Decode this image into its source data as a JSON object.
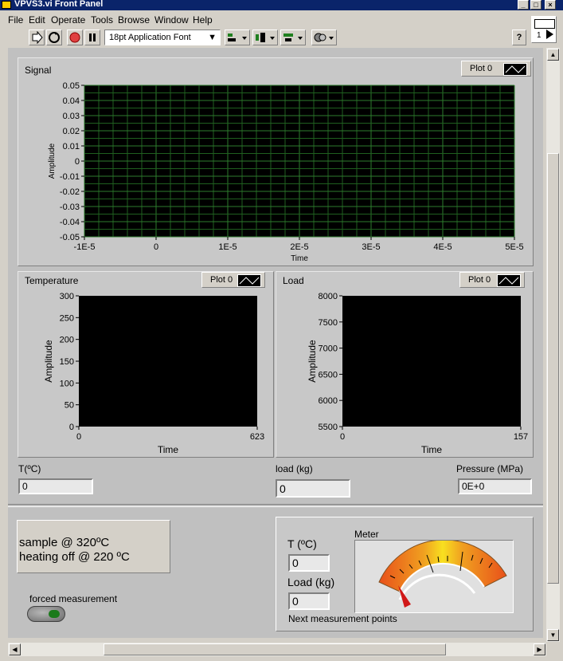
{
  "window": {
    "title": "VPVS3.vi Front Panel"
  },
  "menu": [
    "File",
    "Edit",
    "Operate",
    "Tools",
    "Browse",
    "Window",
    "Help"
  ],
  "toolbar": {
    "font_select": "18pt Application Font",
    "help": "?",
    "vi_icon_label": "1"
  },
  "signal_chart": {
    "label": "Signal",
    "legend": "Plot 0"
  },
  "temperature_chart": {
    "label": "Temperature",
    "legend": "Plot 0"
  },
  "load_chart": {
    "label": "Load",
    "legend": "Plot 0"
  },
  "indicators": {
    "t_label": "T(ºC)",
    "t_value": "0",
    "load_label": "load (kg)",
    "load_value": "0",
    "pressure_label": "Pressure (MPa)",
    "pressure_value": "0E+0"
  },
  "status": {
    "line1": "sample @ 320ºC",
    "line2": "heating off @ 220 ºC"
  },
  "forced": {
    "label": "forced measurement"
  },
  "next": {
    "t_label": "T (ºC)",
    "t_value": "0",
    "load_label": "Load (kg)",
    "load_value": "0",
    "caption": "Next measurement points",
    "meter_label": "Meter"
  },
  "chart_data": [
    {
      "type": "line",
      "title": "Signal",
      "xlabel": "Time",
      "ylabel": "Amplitude",
      "xlim": [
        -1e-05,
        5e-05
      ],
      "ylim": [
        -0.05,
        0.05
      ],
      "xticks": [
        "-1E-5",
        "0",
        "1E-5",
        "2E-5",
        "3E-5",
        "4E-5",
        "5E-5"
      ],
      "yticks": [
        "0.05",
        "0.04",
        "0.03",
        "0.02",
        "0.01",
        "0",
        "-0.01",
        "-0.02",
        "-0.03",
        "-0.04",
        "-0.05"
      ],
      "grid": true,
      "legend_position": "top-right",
      "series": [
        {
          "name": "Plot 0",
          "values": []
        }
      ]
    },
    {
      "type": "line",
      "title": "Temperature",
      "xlabel": "Time",
      "ylabel": "Amplitude",
      "xlim": [
        0,
        623
      ],
      "ylim": [
        0,
        300
      ],
      "xticks": [
        "0",
        "623"
      ],
      "yticks": [
        "300",
        "250",
        "200",
        "150",
        "100",
        "50",
        "0"
      ],
      "grid": false,
      "legend_position": "top-right",
      "series": [
        {
          "name": "Plot 0",
          "values": []
        }
      ]
    },
    {
      "type": "line",
      "title": "Load",
      "xlabel": "Time",
      "ylabel": "Amplitude",
      "xlim": [
        0,
        157
      ],
      "ylim": [
        5500,
        8000
      ],
      "xticks": [
        "0",
        "157"
      ],
      "yticks": [
        "8000",
        "7500",
        "7000",
        "6500",
        "6000",
        "5500"
      ],
      "grid": false,
      "legend_position": "top-right",
      "series": [
        {
          "name": "Plot 0",
          "values": []
        }
      ]
    }
  ],
  "colors": {
    "plot_bg": "#000000",
    "grid": "#1f5f1f",
    "title_bar": "#0a246a",
    "panel": "#c0c0c0"
  }
}
